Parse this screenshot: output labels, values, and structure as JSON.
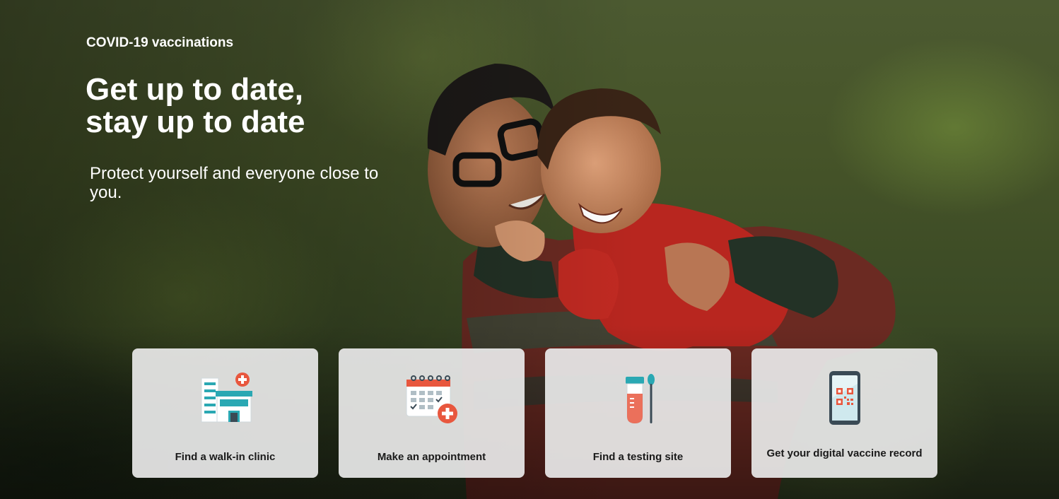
{
  "hero": {
    "eyebrow": "COVID-19 vaccinations",
    "headline_line1": "Get up to date,",
    "headline_line2": "stay up to date",
    "subtitle": "Protect yourself and everyone close to you."
  },
  "cards": [
    {
      "label": "Find a walk-in clinic",
      "icon": "clinic-building-icon"
    },
    {
      "label": "Make an appointment",
      "icon": "calendar-plus-icon"
    },
    {
      "label": "Find a testing site",
      "icon": "test-tube-swab-icon"
    },
    {
      "label": "Get your digital vaccine record",
      "icon": "phone-qr-code-icon"
    }
  ],
  "colors": {
    "accent_red": "#e8573e",
    "icon_teal": "#2aa8b3",
    "icon_dark": "#3a4a55",
    "card_bg": "#e8e8e8",
    "text_white": "#ffffff"
  }
}
